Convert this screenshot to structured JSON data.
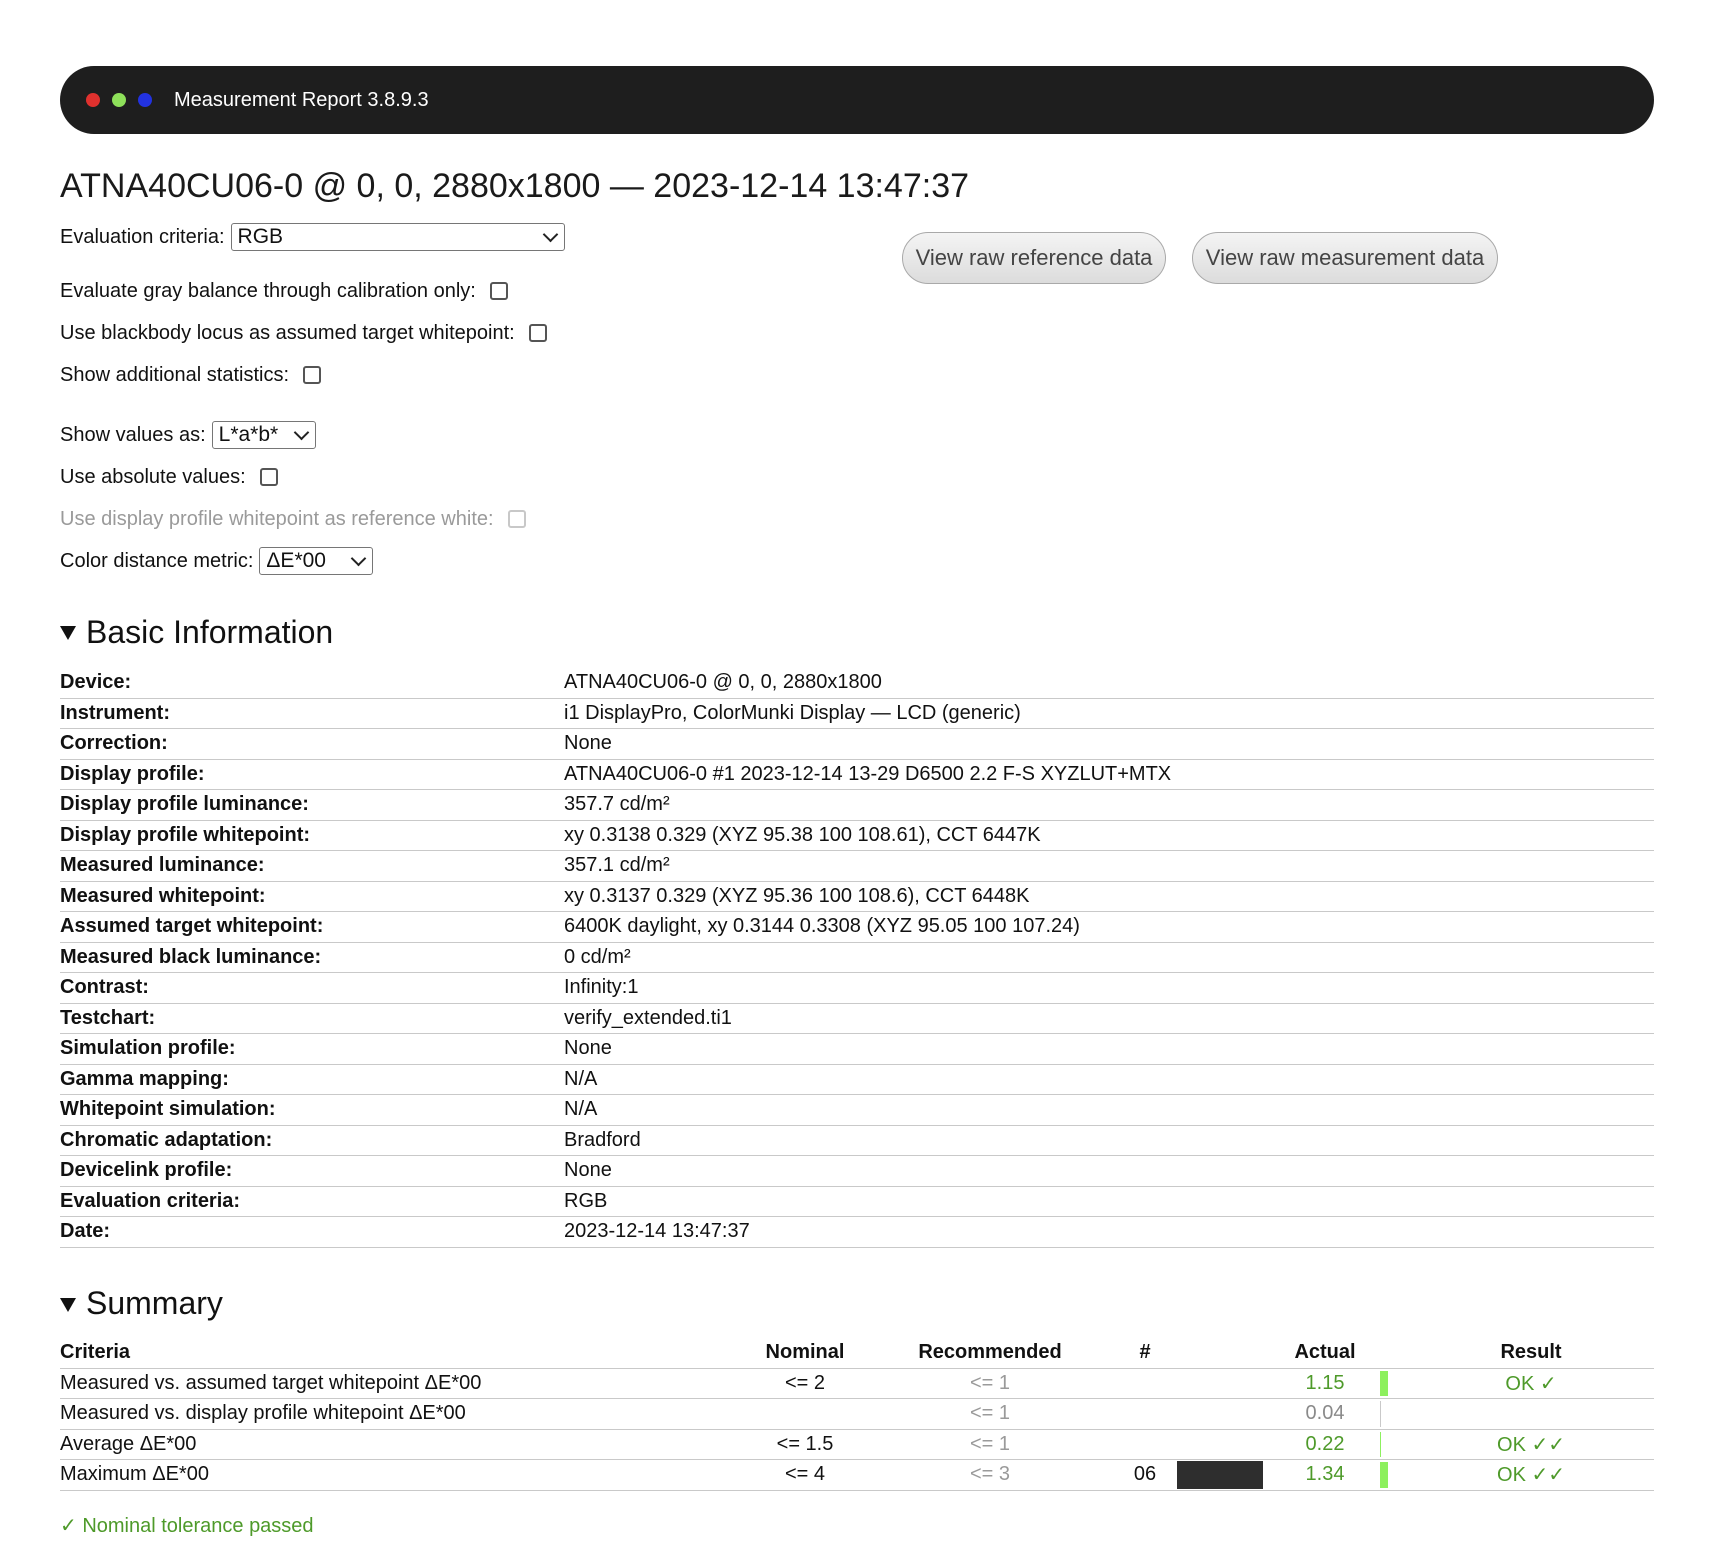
{
  "window": {
    "title": "Measurement Report 3.8.9.3",
    "dots": [
      {
        "name": "close",
        "color": "#e0312e"
      },
      {
        "name": "minimize",
        "color": "#8ee05a"
      },
      {
        "name": "maximize",
        "color": "#2232e0"
      }
    ]
  },
  "report_title": "ATNA40CU06-0 @ 0, 0, 2880x1800 — 2023-12-14 13:47:37",
  "controls": {
    "evaluation_criteria_label": "Evaluation criteria:",
    "evaluation_criteria_value": "RGB",
    "gray_balance_label": "Evaluate gray balance through calibration only:",
    "gray_balance_checked": false,
    "blackbody_label": "Use blackbody locus as assumed target whitepoint:",
    "blackbody_checked": false,
    "additional_stats_label": "Show additional statistics:",
    "additional_stats_checked": false,
    "show_values_label": "Show values as:",
    "show_values_value": "L*a*b*",
    "absolute_values_label": "Use absolute values:",
    "absolute_values_checked": false,
    "profile_whitepoint_label": "Use display profile whitepoint as reference white:",
    "profile_whitepoint_disabled": true,
    "color_distance_label": "Color distance metric:",
    "color_distance_value": "ΔE*00",
    "view_reference_label": "View raw reference data",
    "view_measurement_label": "View raw measurement data"
  },
  "basic_info": {
    "heading": "Basic Information",
    "rows": [
      {
        "key": "Device:",
        "value": "ATNA40CU06-0 @ 0, 0, 2880x1800"
      },
      {
        "key": "Instrument:",
        "value": "i1 DisplayPro, ColorMunki Display — LCD (generic)"
      },
      {
        "key": "Correction:",
        "value": "None"
      },
      {
        "key": "Display profile:",
        "value": "ATNA40CU06-0 #1 2023-12-14 13-29 D6500 2.2 F-S XYZLUT+MTX"
      },
      {
        "key": "Display profile luminance:",
        "value": "357.7 cd/m²"
      },
      {
        "key": "Display profile whitepoint:",
        "value": "xy 0.3138 0.329 (XYZ 95.38 100 108.61), CCT 6447K"
      },
      {
        "key": "Measured luminance:",
        "value": "357.1 cd/m²"
      },
      {
        "key": "Measured whitepoint:",
        "value": "xy 0.3137 0.329 (XYZ 95.36 100 108.6), CCT 6448K"
      },
      {
        "key": "Assumed target whitepoint:",
        "value": "6400K daylight, xy 0.3144 0.3308 (XYZ 95.05 100 107.24)"
      },
      {
        "key": "Measured black luminance:",
        "value": "0 cd/m²"
      },
      {
        "key": "Contrast:",
        "value": "Infinity:1"
      },
      {
        "key": "Testchart:",
        "value": "verify_extended.ti1"
      },
      {
        "key": "Simulation profile:",
        "value": "None"
      },
      {
        "key": "Gamma mapping:",
        "value": "N/A"
      },
      {
        "key": "Whitepoint simulation:",
        "value": "N/A"
      },
      {
        "key": "Chromatic adaptation:",
        "value": "Bradford"
      },
      {
        "key": "Devicelink profile:",
        "value": "None"
      },
      {
        "key": "Evaluation criteria:",
        "value": "RGB"
      },
      {
        "key": "Date:",
        "value": "2023-12-14 13:47:37"
      }
    ]
  },
  "summary": {
    "heading": "Summary",
    "columns": [
      "Criteria",
      "Nominal",
      "Recommended",
      "#",
      "Actual",
      "Result"
    ],
    "rows": [
      {
        "criteria": "Measured vs. assumed target whitepoint ΔE*00",
        "nominal": "<= 2",
        "recommended": "<= 1",
        "num": "",
        "swatch": false,
        "actual": "1.15",
        "bar_fraction": 0.28,
        "result": "OK ✓",
        "actual_green": true
      },
      {
        "criteria": "Measured vs. display profile whitepoint ΔE*00",
        "nominal": "",
        "recommended": "<= 1",
        "num": "",
        "swatch": false,
        "actual": "0.04",
        "bar_fraction": 0.0,
        "result": "",
        "actual_green": false
      },
      {
        "criteria": "Average ΔE*00",
        "nominal": "<= 1.5",
        "recommended": "<= 1",
        "num": "",
        "swatch": false,
        "actual": "0.22",
        "bar_fraction": 0.05,
        "result": "OK ✓✓",
        "actual_green": true
      },
      {
        "criteria": "Maximum ΔE*00",
        "nominal": "<= 4",
        "recommended": "<= 3",
        "num": "06",
        "swatch": true,
        "swatch_color": "#2e2e2e",
        "actual": "1.34",
        "bar_fraction": 0.28,
        "result": "OK ✓✓",
        "actual_green": true
      }
    ],
    "status": "✓ Nominal tolerance passed"
  },
  "colors": {
    "ok_green": "#4e9a2a",
    "bar_green": "#8df05e",
    "titlebar": "#1e1e1e"
  }
}
